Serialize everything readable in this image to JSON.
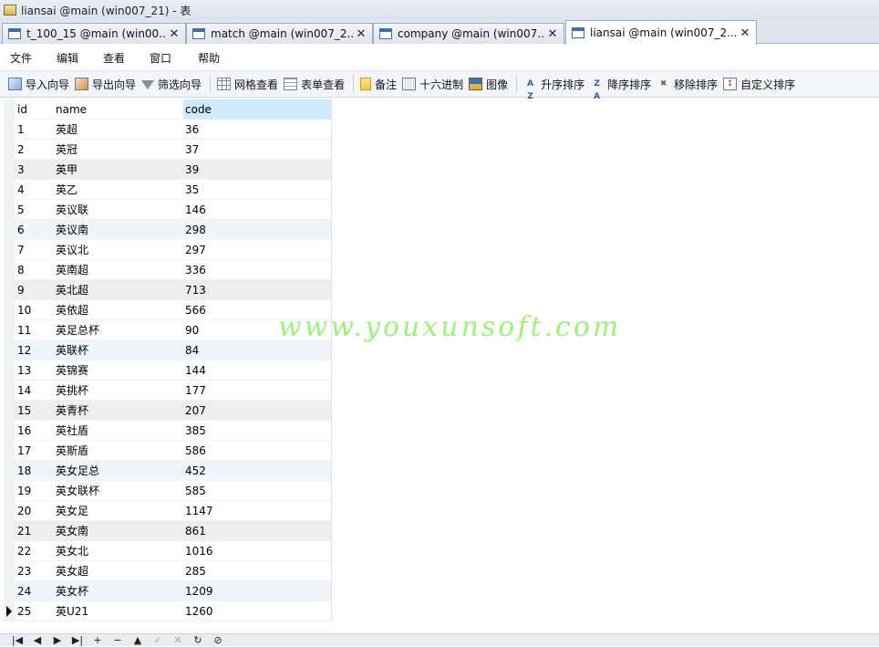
{
  "window": {
    "title": "liansai @main (win007_21) - 表"
  },
  "tabs": [
    {
      "label": "t_100_15 @main (win00...",
      "close": "✕"
    },
    {
      "label": "match @main (win007_2...",
      "close": "✕"
    },
    {
      "label": "company @main (win007...",
      "close": "✕"
    },
    {
      "label": "liansai @main (win007_2...",
      "close": "✕"
    }
  ],
  "menu": [
    "文件",
    "编辑",
    "查看",
    "窗口",
    "帮助"
  ],
  "toolbar": {
    "import_wizard": "导入向导",
    "export_wizard": "导出向导",
    "filter_wizard": "筛选向导",
    "grid_view": "网格查看",
    "form_view": "表单查看",
    "memo": "备注",
    "hex": "十六进制",
    "image": "图像",
    "sort_asc": "升序排序",
    "sort_desc": "降序排序",
    "remove_sort": "移除排序",
    "custom_sort": "自定义排序",
    "sort_asc_icon_text": "A Z",
    "sort_desc_icon_text": "Z A",
    "custom_sort_icon_text": "↕"
  },
  "table": {
    "columns": [
      "id",
      "name",
      "code"
    ],
    "rows": [
      [
        "1",
        "英超",
        "36"
      ],
      [
        "2",
        "英冠",
        "37"
      ],
      [
        "3",
        "英甲",
        "39"
      ],
      [
        "4",
        "英乙",
        "35"
      ],
      [
        "5",
        "英议联",
        "146"
      ],
      [
        "6",
        "英议南",
        "298"
      ],
      [
        "7",
        "英议北",
        "297"
      ],
      [
        "8",
        "英南超",
        "336"
      ],
      [
        "9",
        "英北超",
        "713"
      ],
      [
        "10",
        "英依超",
        "566"
      ],
      [
        "11",
        "英足总杯",
        "90"
      ],
      [
        "12",
        "英联杯",
        "84"
      ],
      [
        "13",
        "英锦赛",
        "144"
      ],
      [
        "14",
        "英挑杯",
        "177"
      ],
      [
        "15",
        "英青杯",
        "207"
      ],
      [
        "16",
        "英社盾",
        "385"
      ],
      [
        "17",
        "英斯盾",
        "586"
      ],
      [
        "18",
        "英女足总",
        "452"
      ],
      [
        "19",
        "英女联杯",
        "585"
      ],
      [
        "20",
        "英女足",
        "1147"
      ],
      [
        "21",
        "英女南",
        "861"
      ],
      [
        "22",
        "英女北",
        "1016"
      ],
      [
        "23",
        "英女超",
        "285"
      ],
      [
        "24",
        "英女杯",
        "1209"
      ],
      [
        "25",
        "英U21",
        "1260"
      ]
    ],
    "current_row": 25
  },
  "watermark": "www.youxunsoft.com",
  "navigator": [
    "|◀",
    "◀",
    "▶",
    "▶|",
    "+",
    "−",
    "▲",
    "✓",
    "✕",
    "↻",
    "⊘"
  ]
}
